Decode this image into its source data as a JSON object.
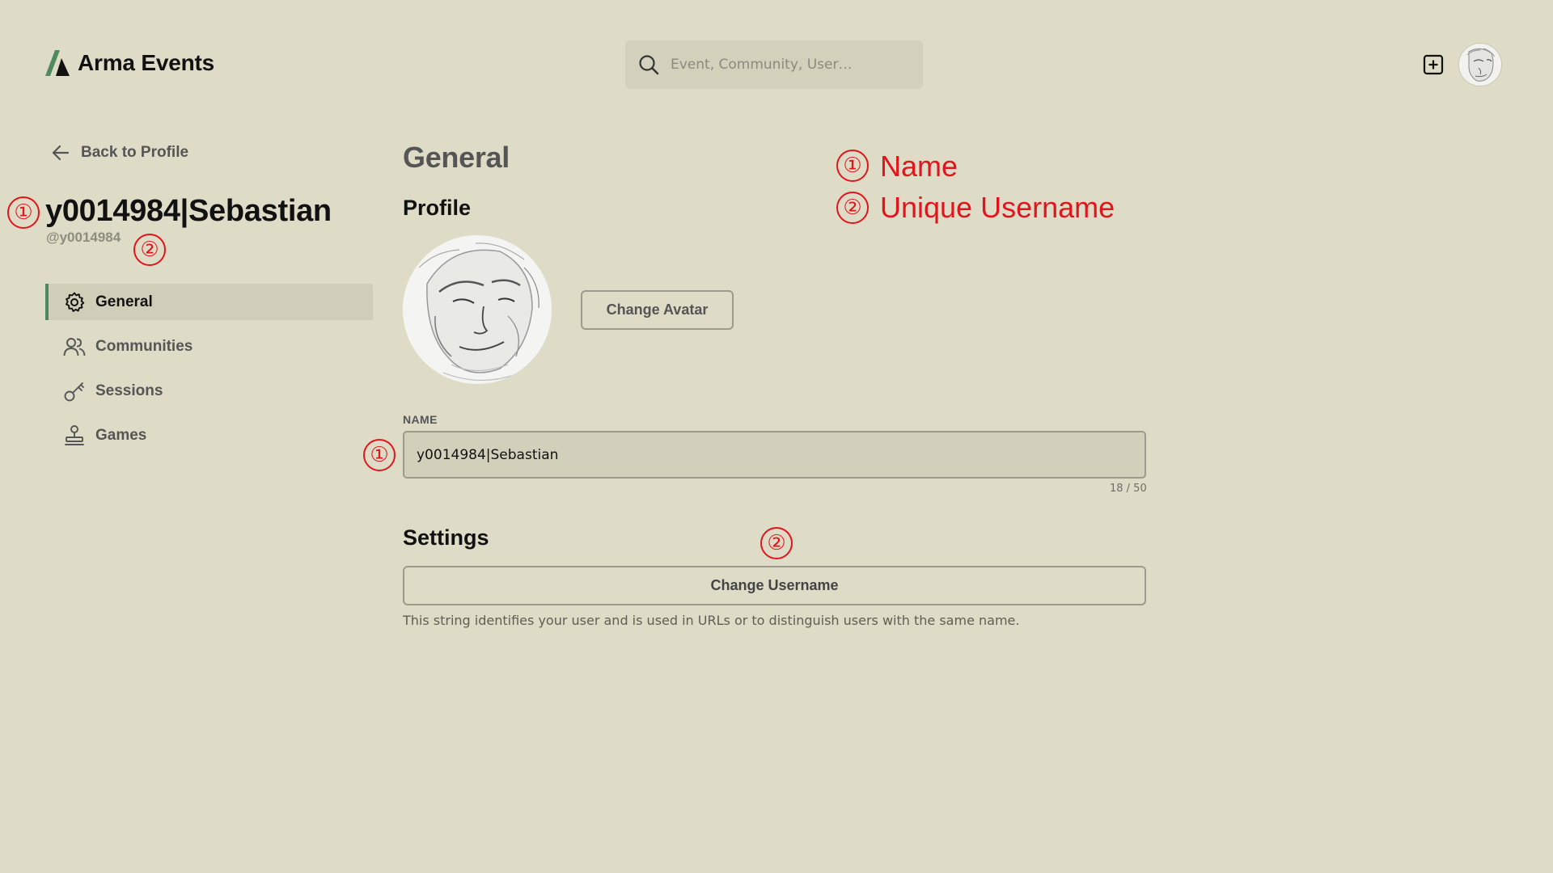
{
  "app": {
    "title": "Arma Events"
  },
  "header": {
    "search_placeholder": "Event, Community, User…",
    "icons": [
      "logo-icon",
      "search-icon",
      "add-square-icon",
      "avatar"
    ]
  },
  "sidebar": {
    "back_label": "Back to Profile",
    "display_name": "y0014984|Sebastian",
    "username": "@y0014984",
    "items": [
      {
        "label": "General",
        "icon": "gear-icon",
        "active": true
      },
      {
        "label": "Communities",
        "icon": "users-icon",
        "active": false
      },
      {
        "label": "Sessions",
        "icon": "key-icon",
        "active": false
      },
      {
        "label": "Games",
        "icon": "stamp-icon",
        "active": false
      }
    ]
  },
  "main": {
    "title": "General",
    "profile_heading": "Profile",
    "change_avatar_label": "Change Avatar",
    "name_label": "NAME",
    "name_value": "y0014984|Sebastian",
    "name_count": "18 / 50",
    "settings_heading": "Settings",
    "change_username_label": "Change Username",
    "settings_help": "This string identifies your user and is used in URLs or to distinguish users with the same name."
  },
  "annotations": {
    "marker_1": "①",
    "marker_2": "②",
    "legend_1": "Name",
    "legend_2": "Unique Username",
    "color": "#e0161c"
  },
  "colors": {
    "background": "#dedcc6",
    "accent": "#4f8a5e",
    "annotation": "#e0161c"
  }
}
